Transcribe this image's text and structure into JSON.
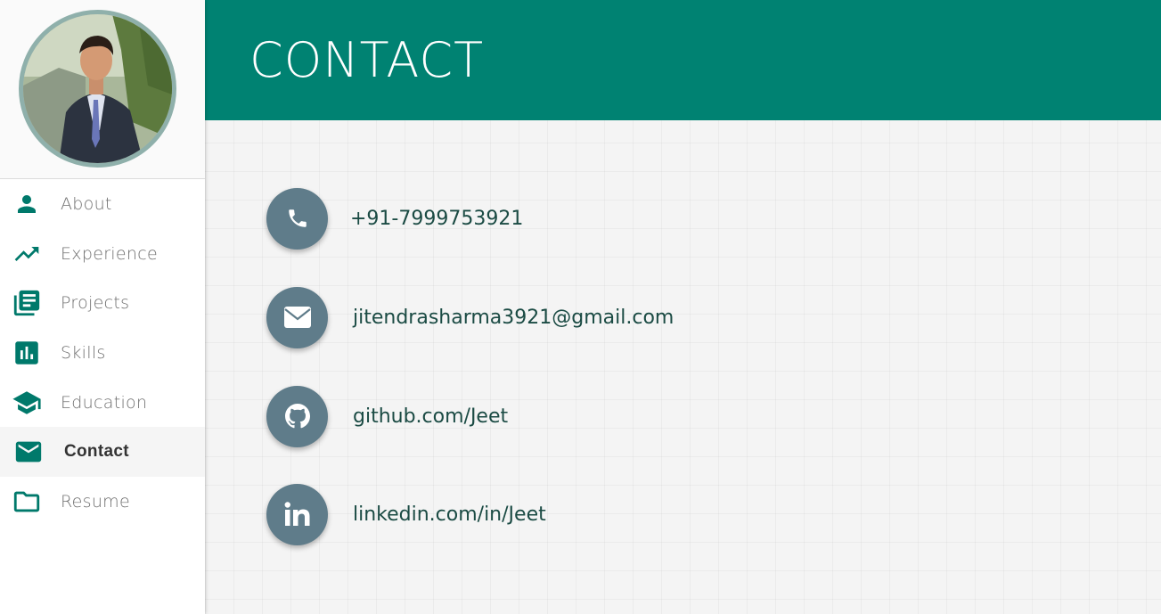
{
  "sidebar": {
    "nav": [
      {
        "label": "About",
        "icon": "person-icon"
      },
      {
        "label": "Experience",
        "icon": "trending-up-icon"
      },
      {
        "label": "Projects",
        "icon": "library-books-icon"
      },
      {
        "label": "Skills",
        "icon": "bar-chart-icon"
      },
      {
        "label": "Education",
        "icon": "school-icon"
      },
      {
        "label": "Contact",
        "icon": "mail-icon",
        "active": true
      },
      {
        "label": "Resume",
        "icon": "folder-icon"
      }
    ]
  },
  "header": {
    "title": "CONTACT"
  },
  "contacts": [
    {
      "icon": "phone-icon",
      "text": "+91-7999753921"
    },
    {
      "icon": "envelope-icon",
      "text": "jitendrasharma3921@gmail.com"
    },
    {
      "icon": "github-icon",
      "text": "github.com/Jeet"
    },
    {
      "icon": "linkedin-icon",
      "text": "linkedin.com/in/Jeet"
    }
  ],
  "colors": {
    "accent": "#008272",
    "icon_teal": "#00796b",
    "contact_circle": "#5f7c8a",
    "contact_text": "#1b4b44"
  }
}
